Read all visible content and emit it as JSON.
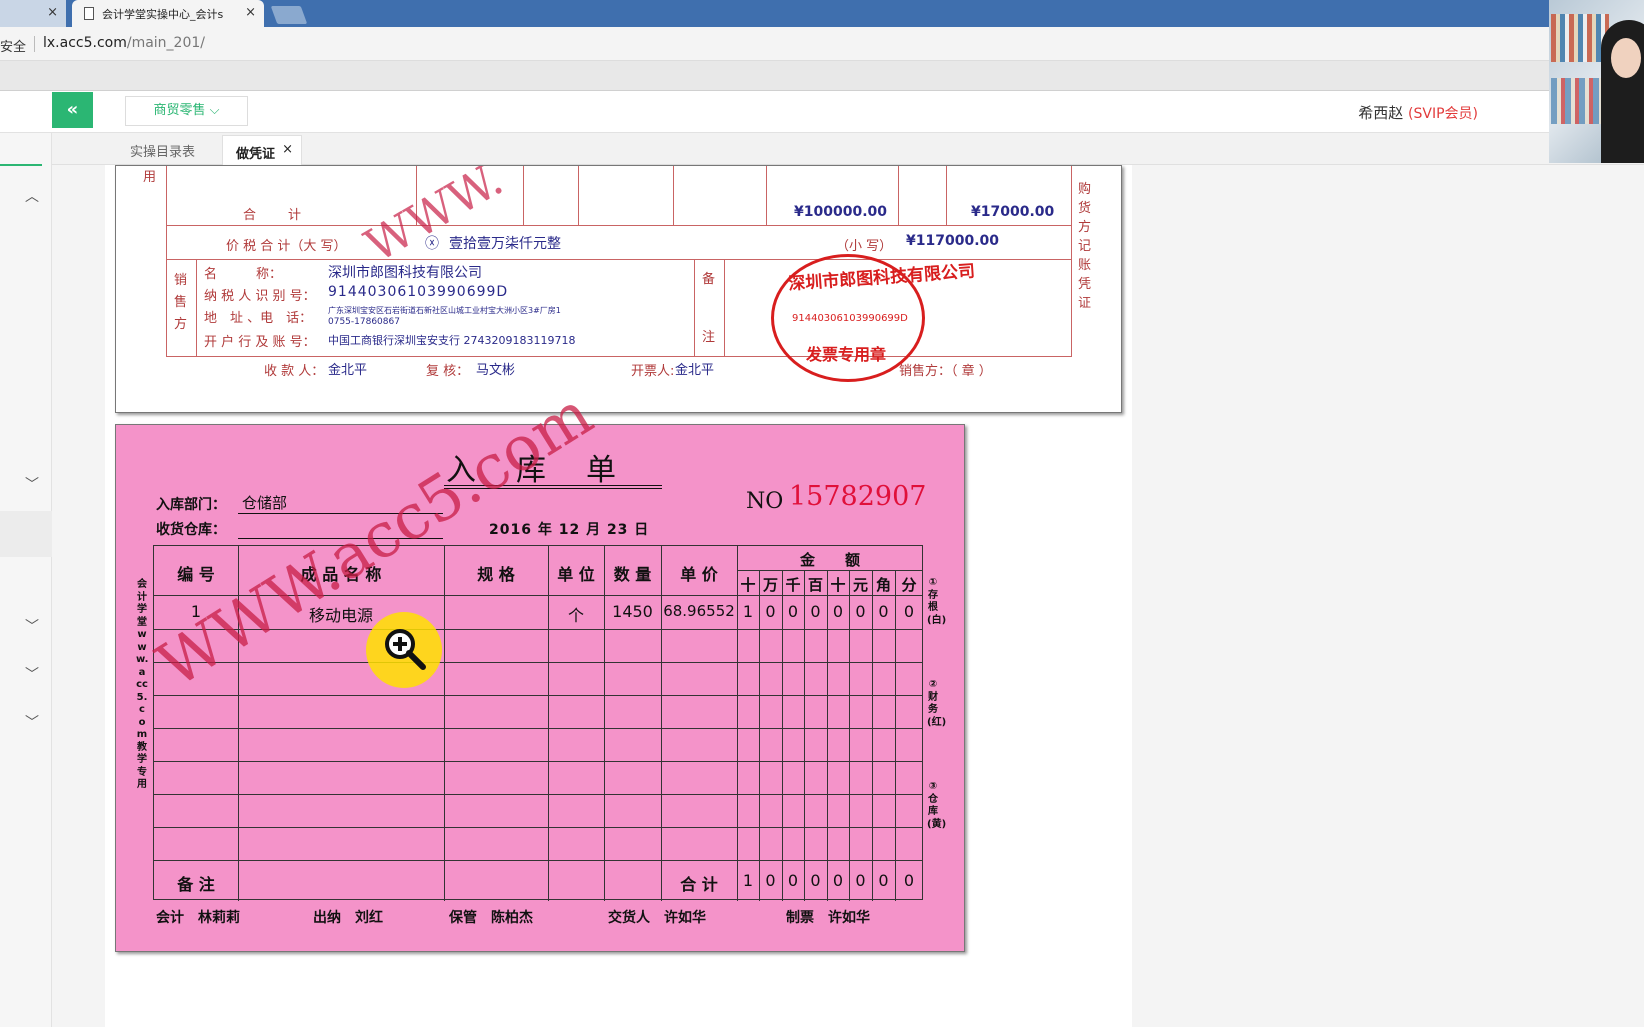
{
  "browser": {
    "tab_title": "会计学堂实操中心_会计s",
    "secure_label": "安全",
    "url_host": "lx.acc5.com",
    "url_path": "/main_201/"
  },
  "header": {
    "collapse_glyph": "«",
    "dropdown_label": "商贸零售",
    "dropdown_caret": "⌵",
    "user_name": "希西赵",
    "user_badge": "(SVIP会员)"
  },
  "tabs": [
    {
      "label": "实操目录表"
    },
    {
      "label": "做凭证",
      "close": "×"
    }
  ],
  "invoice": {
    "partial_label": "用",
    "total_label": "合　　计",
    "total_amount": "¥100000.00",
    "total_tax": "¥17000.00",
    "sum_label": "价 税 合 计（大 写）",
    "sum_mark": "ⓧ",
    "sum_words": "壹拾壹万柒仟元整",
    "sum_small_label": "（小 写）",
    "sum_small": "¥117000.00",
    "seller_side_label": "销售方",
    "name_label": "名　　　称：",
    "name": "深圳市郎图科技有限公司",
    "tax_id_label": "纳 税 人 识 别 号：",
    "tax_id": "91440306103990699D",
    "address_label": "地　址 、电　话：",
    "address": "广东深圳宝安区石岩街道石新社区山城工业村宝大洲小区3#厂房1",
    "phone": "0755-17860867",
    "bank_label": "开 户 行 及 账 号：",
    "bank": "中国工商银行深圳宝安支行 2743209183119718",
    "remark_top": "备",
    "remark_bottom": "注",
    "payee_label": "收 款 人：",
    "payee": "金北平",
    "reviewer_label": "复 核：",
    "reviewer": "马文彬",
    "issuer_label": "开票人:",
    "issuer": "金北平",
    "seller_label": "销售方：（ 章 ）",
    "side_note": "购货方记账凭证",
    "stamp_top": "深圳市郎图科技有限公司",
    "stamp_number": "91440306103990699D",
    "stamp_bottom": "发票专用章",
    "watermark": "WWW."
  },
  "receipt": {
    "title": "入库单",
    "dept_label": "入库部门：",
    "dept": "仓储部",
    "warehouse_label": "收货仓库：",
    "date": "2016 年 12 月 23 日",
    "no_label": "NO",
    "no": "15782907",
    "headers": {
      "id": "编 号",
      "name": "成 品 名 称",
      "spec": "规 格",
      "unit": "单 位",
      "qty": "数 量",
      "price": "单 价",
      "amount": "金　　额"
    },
    "digit_headers": [
      "十",
      "万",
      "千",
      "百",
      "十",
      "元",
      "角",
      "分"
    ],
    "rows": [
      {
        "id": "1",
        "name": "移动电源",
        "spec": "",
        "unit": "个",
        "qty": "1450",
        "price": "68.96552",
        "digits": [
          "1",
          "0",
          "0",
          "0",
          "0",
          "0",
          "0",
          "0"
        ]
      }
    ],
    "remark_label": "备 注",
    "total_label": "合 计",
    "total_digits": [
      "1",
      "0",
      "0",
      "0",
      "0",
      "0",
      "0",
      "0"
    ],
    "left_vertical": "会计学堂www.acc5.com教学专用",
    "right_copy1": "①存根(白)",
    "right_copy2": "②财务(红)",
    "right_copy3": "③仓库(黄)",
    "signatures": [
      {
        "label": "会计",
        "name": "林莉莉"
      },
      {
        "label": "出纳",
        "name": "刘红"
      },
      {
        "label": "保管",
        "name": "陈柏杰"
      },
      {
        "label": "交货人",
        "name": "许如华"
      },
      {
        "label": "制票",
        "name": "许如华"
      }
    ],
    "watermark": "WWW.acc5.com"
  }
}
